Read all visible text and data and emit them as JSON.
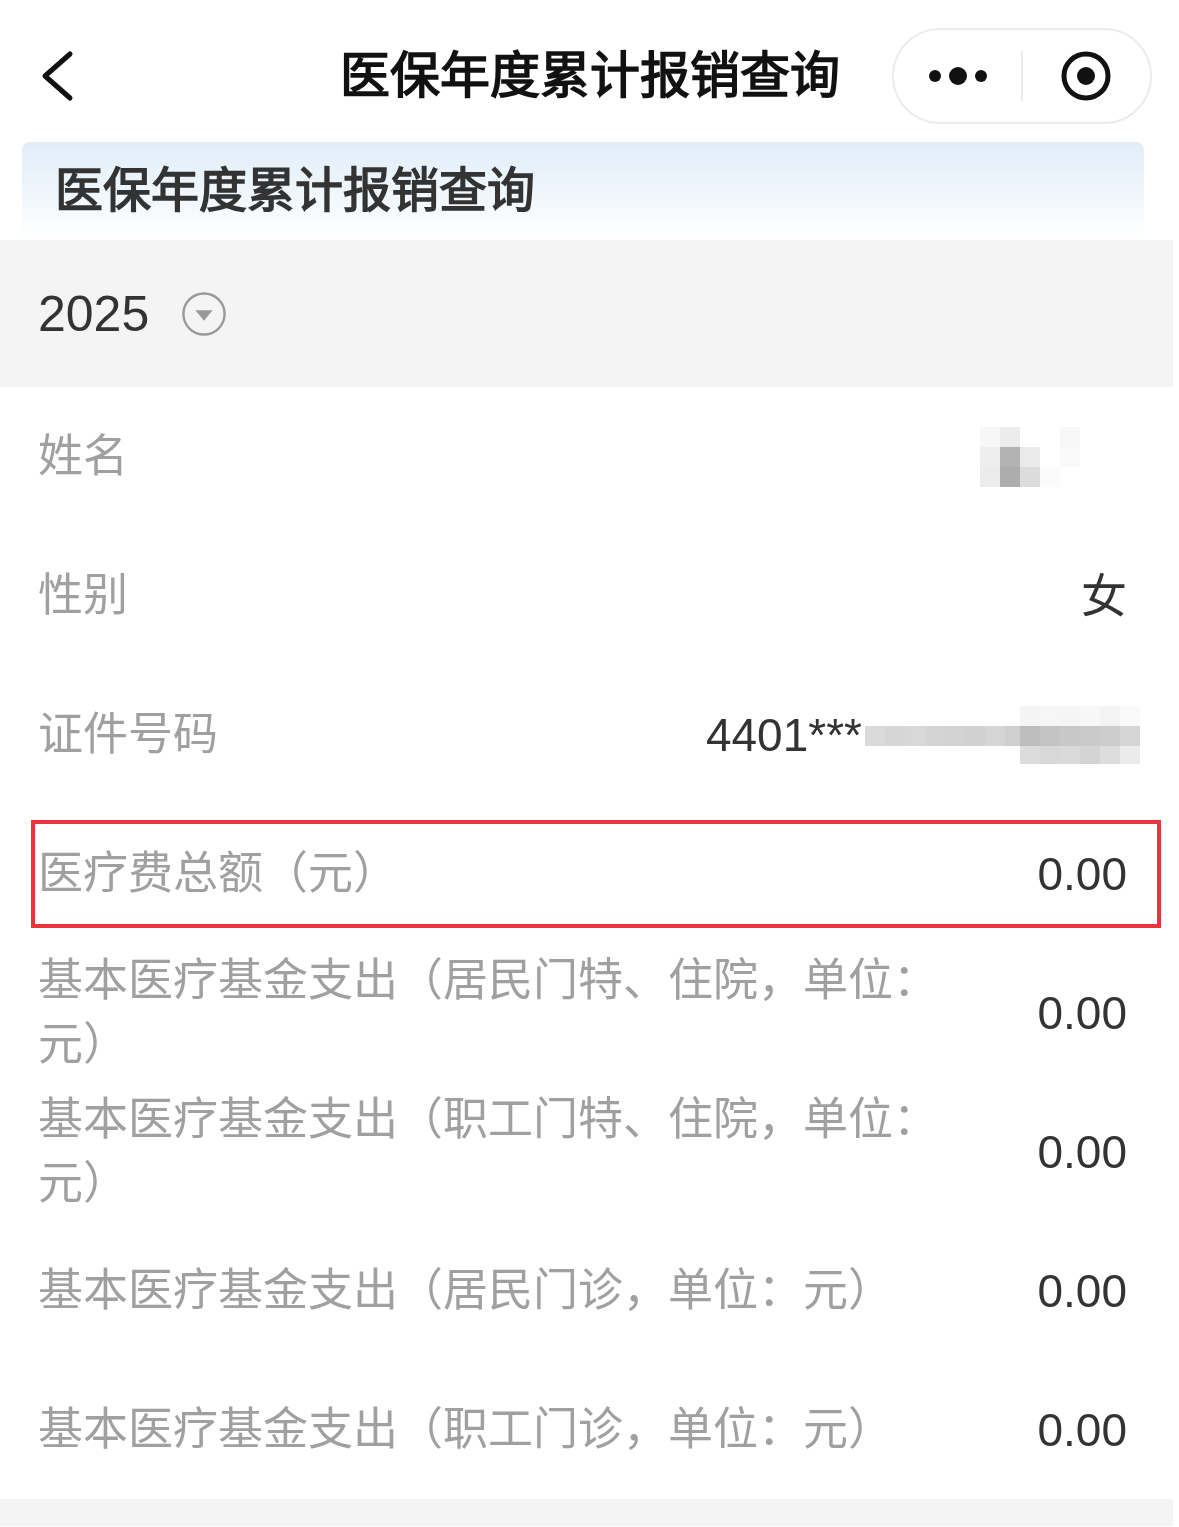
{
  "nav": {
    "title": "医保年度累计报销查询"
  },
  "banner": {
    "title": "医保年度累计报销查询"
  },
  "year_selector": {
    "value": "2025"
  },
  "rows": [
    {
      "label": "姓名",
      "redacted": true,
      "highlighted": false
    },
    {
      "label": "性别",
      "value": "女",
      "redacted": false,
      "highlighted": false
    },
    {
      "label": "证件号码",
      "value": "4401***",
      "redacted": true,
      "highlighted": false
    },
    {
      "label": "医疗费总额（元）",
      "value": "0.00",
      "redacted": false,
      "highlighted": true
    },
    {
      "label": "基本医疗基金支出（居民门特、住院，单位：元）",
      "value": "0.00",
      "redacted": false,
      "highlighted": false
    },
    {
      "label": "基本医疗基金支出（职工门特、住院，单位：元）",
      "value": "0.00",
      "redacted": false,
      "highlighted": false
    },
    {
      "label": "基本医疗基金支出（居民门诊，单位：元）",
      "value": "0.00",
      "redacted": false,
      "highlighted": false
    },
    {
      "label": "基本医疗基金支出（职工门诊，单位：元）",
      "value": "0.00",
      "redacted": false,
      "highlighted": false
    }
  ]
}
